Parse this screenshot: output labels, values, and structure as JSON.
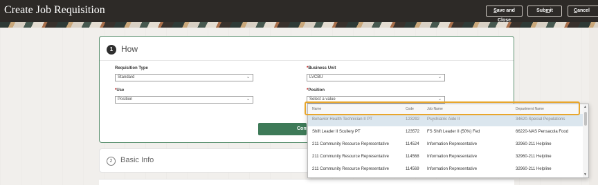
{
  "header": {
    "title": "Create Job Requisition",
    "save_close_label_pre": "",
    "save_close_underline": "S",
    "save_close_label_post": "ave and Close",
    "submit_pre": "Sub",
    "submit_underline": "m",
    "submit_post": "it",
    "cancel_underline": "C",
    "cancel_post": "ancel"
  },
  "step1": {
    "number": "1",
    "title": "How",
    "fields": {
      "requisition_type_label": "Requisition Type",
      "requisition_type_value": "Standard",
      "business_unit_label": "Business Unit",
      "business_unit_value": "LVCBU",
      "use_label": "Use",
      "use_value": "Position",
      "position_label": "Position",
      "position_placeholder": "Select a value"
    },
    "continue_label": "Continue"
  },
  "step2": {
    "number": "2",
    "title": "Basic Info"
  },
  "position_popup": {
    "columns": [
      "Name",
      "Code",
      "Job Name",
      "Department Name"
    ],
    "rows": [
      {
        "name": "Behavior Health Technician II PT",
        "code": "123292",
        "job": "Psychiatric Aide II",
        "dept": "34620-Special Populations"
      },
      {
        "name": "Shift Leader II Scullery PT",
        "code": "123572",
        "job": "FS Shift Leader II (50%) Fed",
        "dept": "66220-NAS Pensacola Food"
      },
      {
        "name": "211 Community Resource Representative",
        "code": "114524",
        "job": "Information Representative",
        "dept": "32960-211 Helpline"
      },
      {
        "name": "211 Community Resource Representative",
        "code": "114568",
        "job": "Information Representative",
        "dept": "32960-211 Helpline"
      },
      {
        "name": "211 Community Resource Representative",
        "code": "114569",
        "job": "Information Representative",
        "dept": "32960-211 Helpline"
      }
    ]
  },
  "icons": {
    "chevron": "chevron-down-icon",
    "scroll_up": "scroll-up-icon",
    "scroll_down": "scroll-down-icon"
  },
  "colors": {
    "header_bg": "#2d2a27",
    "accent_green": "#3e7a58",
    "highlight": "#e8a62c"
  }
}
